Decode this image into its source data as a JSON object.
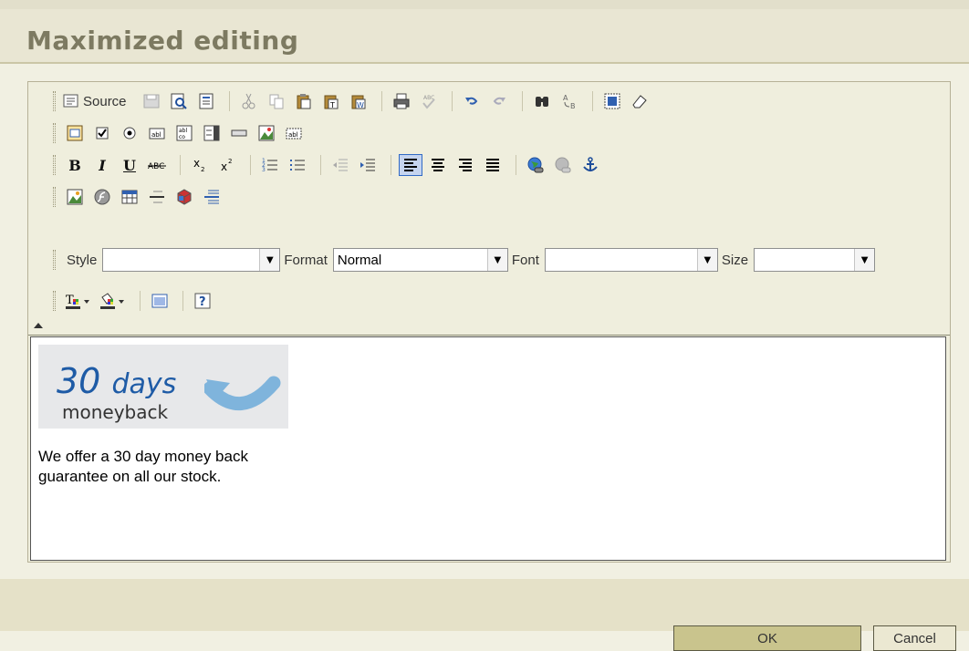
{
  "dialog": {
    "title": "Maximized editing"
  },
  "toolbar": {
    "source_label": "Source",
    "style": {
      "label": "Style",
      "value": ""
    },
    "format": {
      "label": "Format",
      "value": "Normal"
    },
    "font": {
      "label": "Font",
      "value": ""
    },
    "size": {
      "label": "Size",
      "value": ""
    }
  },
  "content": {
    "banner": {
      "big": "30",
      "days": "days",
      "sub": "moneyback"
    },
    "lines": [
      "We offer a 30 day money back",
      "guarantee on all our stock."
    ]
  },
  "buttons": {
    "ok": "OK",
    "cancel": "Cancel"
  }
}
